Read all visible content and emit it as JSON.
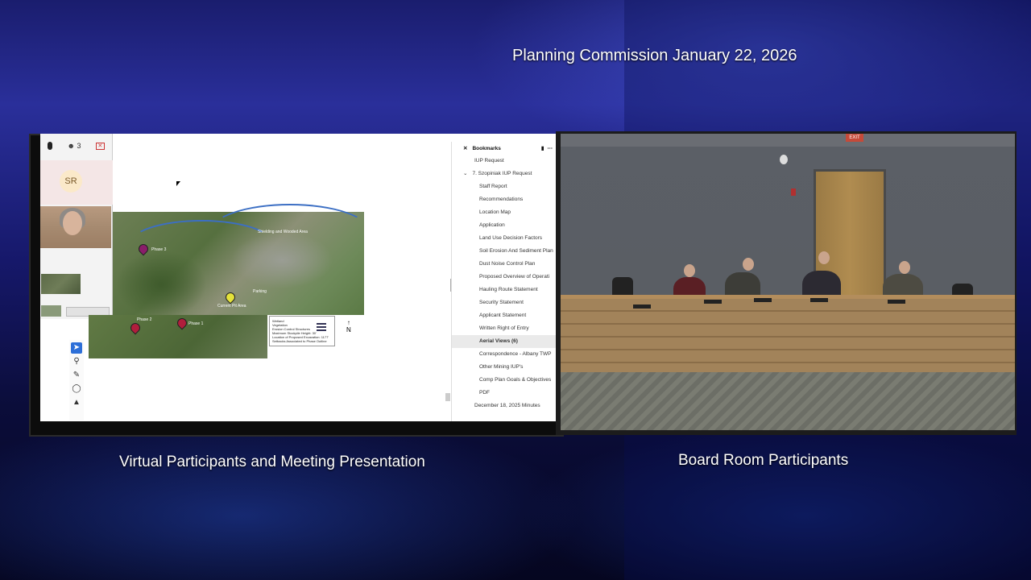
{
  "header": {
    "title": "Planning Commission January 22, 2026"
  },
  "captions": {
    "left": "Virtual Participants and Meeting Presentation",
    "right": "Board Room Participants"
  },
  "virtual_panel": {
    "participant_count": "3",
    "participant_initials": "SR"
  },
  "bookmarks": {
    "title": "Bookmarks",
    "items": [
      {
        "label": "IUP Request",
        "level": 1
      },
      {
        "label": "7. Szopiniak IUP Request",
        "level": 1
      },
      {
        "label": "Staff Report",
        "level": 2
      },
      {
        "label": "Recommendations",
        "level": 2
      },
      {
        "label": "Location Map",
        "level": 2
      },
      {
        "label": "Application",
        "level": 2
      },
      {
        "label": "Land Use Decision Factors",
        "level": 2
      },
      {
        "label": "Soil Erosion And Sediment Plan",
        "level": 2
      },
      {
        "label": "Dust Noise Control Plan",
        "level": 2
      },
      {
        "label": "Proposed Overview of Operati",
        "level": 2
      },
      {
        "label": "Hauling Route Statement",
        "level": 2
      },
      {
        "label": "Security Statement",
        "level": 2
      },
      {
        "label": "Applicant Statement",
        "level": 2
      },
      {
        "label": "Written Right of Entry",
        "level": 2
      },
      {
        "label": "Aerial Views (6)",
        "level": 2,
        "selected": true
      },
      {
        "label": "Correspondence - Albany TWP",
        "level": 2
      },
      {
        "label": "Other Mining IUP's",
        "level": 2
      },
      {
        "label": "Comp Plan Goals & Objectives",
        "level": 2
      },
      {
        "label": "PDF",
        "level": 2
      },
      {
        "label": "December 18, 2025 Minutes",
        "level": 1
      }
    ]
  },
  "map": {
    "labels": {
      "phase1": "Phase 1",
      "phase2": "Phase 2",
      "phase3": "Phase 3",
      "current_pit": "Current Pit Area",
      "parking": "Parking",
      "shielding": "Shielding and Wooded Area",
      "north": "N"
    },
    "legend_lines": [
      "Wetland",
      "Vegetation",
      "Erosion Control Structures",
      "Maximum Stockpile Height: 30'",
      "Location of Proposed Excavation: 1177'",
      "Setbacks Associated to Phase Outline"
    ],
    "pin_colors": {
      "phase": "#b01e3c",
      "current": "#e4e23a",
      "phase3": "#8a1d6a"
    }
  },
  "icons": [
    "mic-icon",
    "participants-icon",
    "close-icon",
    "cursor-icon",
    "select-tool-icon",
    "zoom-tool-icon",
    "pen-tool-icon",
    "lasso-tool-icon",
    "stamp-tool-icon",
    "bookmark-icon",
    "more-icon",
    "collapse-icon",
    "expand-icon",
    "north-arrow-icon"
  ]
}
